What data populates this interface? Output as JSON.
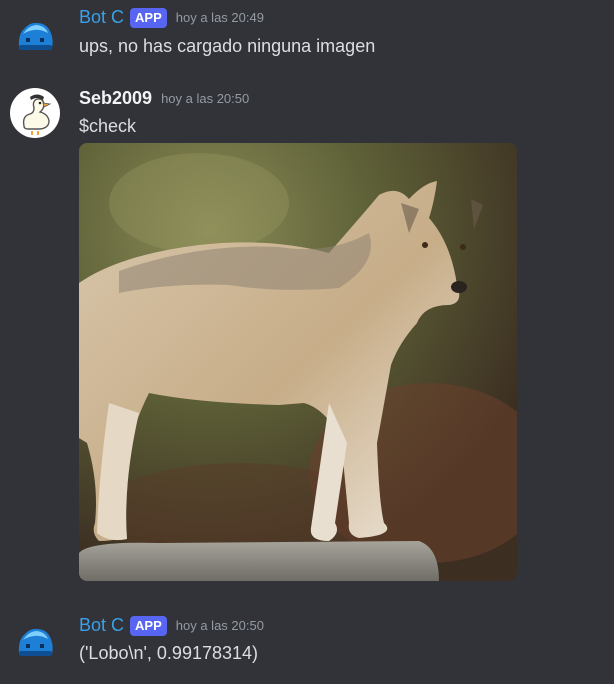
{
  "messages": [
    {
      "author": "Bot C",
      "badge": "APP",
      "timestamp": "hoy a las 20:49",
      "text": "ups, no has cargado ninguna imagen"
    },
    {
      "author": "Seb2009",
      "timestamp": "hoy a las 20:50",
      "text": "$check",
      "attachment": "wolf-photo"
    },
    {
      "author": "Bot C",
      "badge": "APP",
      "timestamp": "hoy a las 20:50",
      "text": "('Lobo\\n', 0.99178314)"
    }
  ],
  "colors": {
    "background": "#313338",
    "bot_name": "#3aa0ea",
    "app_badge": "#5865f2",
    "timestamp": "#949ba4",
    "message_text": "#dbdee1"
  },
  "icons": {
    "bot_avatar": "blue-slime-icon",
    "user_avatar": "duck-icon"
  }
}
